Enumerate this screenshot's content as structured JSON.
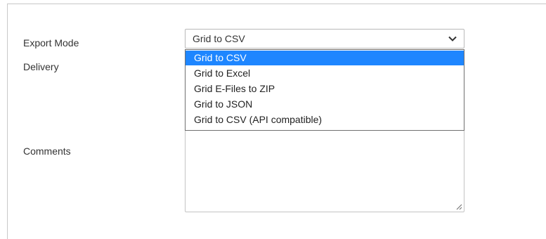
{
  "form": {
    "export_mode_label": "Export Mode",
    "delivery_label": "Delivery",
    "comments_label": "Comments",
    "export_mode_value": "Grid to CSV",
    "comments_value": ""
  },
  "dropdown": {
    "options": [
      "Grid to CSV",
      "Grid to Excel",
      "Grid E-Files to ZIP",
      "Grid to JSON",
      "Grid to CSV (API compatible)"
    ],
    "selected_index": 0
  },
  "icons": {
    "select_arrow": "chevron-down-icon",
    "textarea_resize": "resize-grip-icon"
  },
  "colors": {
    "selected_option_bg": "#1e86ff",
    "selected_option_text": "#ffffff"
  }
}
